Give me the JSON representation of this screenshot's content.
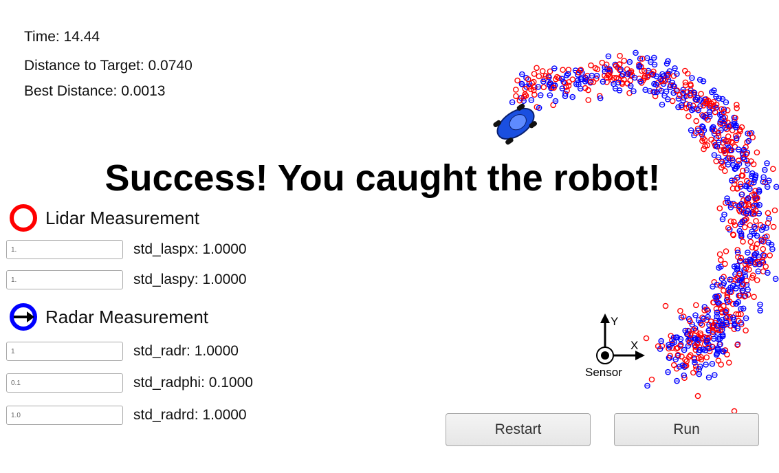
{
  "stats": {
    "time": "Time: 14.44",
    "distance": "Distance to Target: 0.0740",
    "best": "Best Distance: 0.0013"
  },
  "banner": "Success! You caught the robot!",
  "lidar": {
    "label": "Lidar Measurement",
    "color": "#ff0000",
    "fields": [
      {
        "value": "1.",
        "label": "std_laspx: 1.0000"
      },
      {
        "value": "1.",
        "label": "std_laspy: 1.0000"
      }
    ]
  },
  "radar": {
    "label": "Radar Measurement",
    "color": "#0000ff",
    "fields": [
      {
        "value": "1",
        "label": "std_radr: 1.0000"
      },
      {
        "value": "0.1",
        "label": "std_radphi: 0.1000"
      },
      {
        "value": "1.0",
        "label": "std_radrd: 1.0000"
      }
    ]
  },
  "sensor": {
    "x_label": "X",
    "y_label": "Y",
    "name": "Sensor"
  },
  "buttons": {
    "restart": "Restart",
    "run": "Run"
  },
  "colors": {
    "lidar": "#ff0000",
    "radar": "#0000ff",
    "car": "#1a4fe0"
  },
  "icons": {
    "target": "car-icon",
    "lidar": "red-ring-icon",
    "radar": "blue-ring-arrow-icon"
  }
}
